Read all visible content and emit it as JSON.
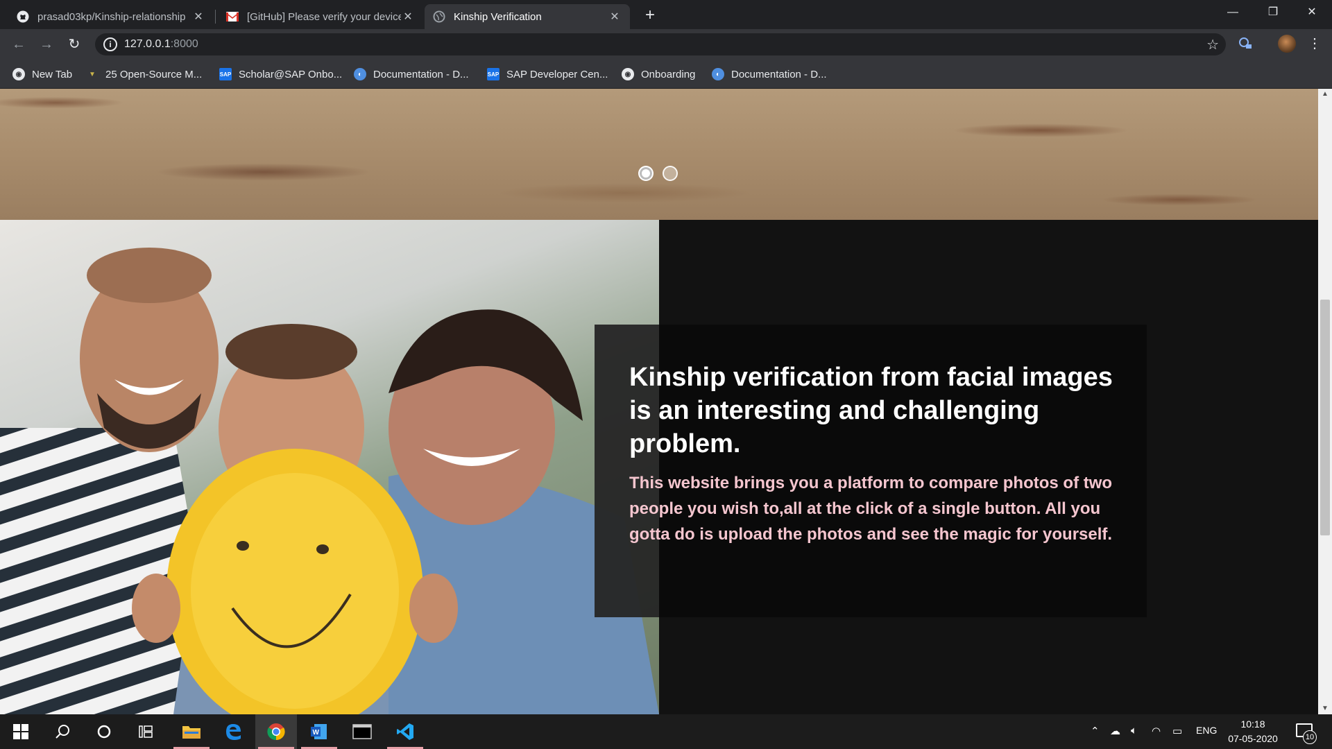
{
  "browser": {
    "tabs": [
      {
        "title": "prasad03kp/Kinship-relationship",
        "icon": "github-icon",
        "active": false
      },
      {
        "title": "[GitHub] Please verify your device",
        "icon": "gmail-icon",
        "active": false
      },
      {
        "title": "Kinship Verification",
        "icon": "globe-icon",
        "active": true
      }
    ],
    "new_tab": "+",
    "window_controls": {
      "minimize": "—",
      "restore": "❐",
      "close": "✕"
    },
    "url_host": "127.0.0.1",
    "url_port": ":8000",
    "bookmarks": [
      {
        "label": "New Tab",
        "icon": "chrome-icon"
      },
      {
        "label": "25 Open-Source M...",
        "icon": "tag-icon"
      },
      {
        "label": "Scholar@SAP Onbo...",
        "icon": "sap-icon"
      },
      {
        "label": "Documentation - D...",
        "icon": "globe-icon"
      },
      {
        "label": "SAP Developer Cen...",
        "icon": "sap-icon"
      },
      {
        "label": "Onboarding",
        "icon": "chrome-icon"
      },
      {
        "label": "Documentation - D...",
        "icon": "globe-icon"
      }
    ]
  },
  "page": {
    "carousel": {
      "slides": 2,
      "active_index": 0
    },
    "headline": "Kinship verification from facial images is an interesting and challenging problem.",
    "description": "This website brings you a platform to compare photos of two people you wish to,all at the click of a single button. All you gotta do is upload the photos and see the magic for yourself."
  },
  "taskbar": {
    "apps": [
      "windows-start-icon",
      "search-icon",
      "cortana-icon",
      "task-view-icon",
      "file-explorer-icon",
      "edge-icon",
      "chrome-icon",
      "word-icon",
      "terminal-icon",
      "vscode-icon"
    ],
    "language": "ENG",
    "time": "10:18",
    "date": "07-05-2020",
    "notification_count": "10"
  }
}
